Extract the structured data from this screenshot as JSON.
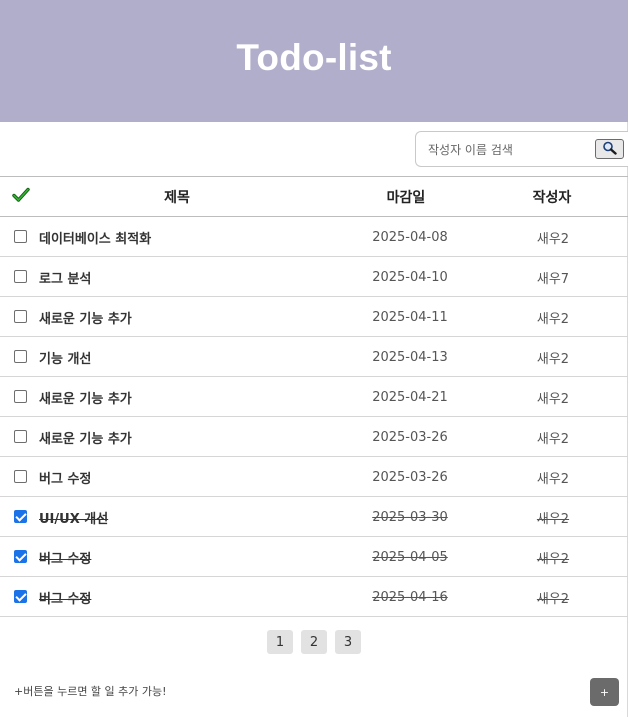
{
  "header": {
    "title": "Todo-list"
  },
  "search": {
    "placeholder": "작성자 이름 검색",
    "value": "",
    "button_icon": "magnifier-icon"
  },
  "table": {
    "columns": {
      "check_icon": "green-check-icon",
      "title": "제목",
      "due": "마감일",
      "author": "작성자"
    },
    "rows": [
      {
        "title": "데이터베이스 최적화",
        "due": "2025-04-08",
        "author": "새우2",
        "done": false
      },
      {
        "title": "로그 분석",
        "due": "2025-04-10",
        "author": "새우7",
        "done": false
      },
      {
        "title": "새로운 기능 추가",
        "due": "2025-04-11",
        "author": "새우2",
        "done": false
      },
      {
        "title": "기능 개선",
        "due": "2025-04-13",
        "author": "새우2",
        "done": false
      },
      {
        "title": "새로운 기능 추가",
        "due": "2025-04-21",
        "author": "새우2",
        "done": false
      },
      {
        "title": "새로운 기능 추가",
        "due": "2025-03-26",
        "author": "새우2",
        "done": false
      },
      {
        "title": "버그 수정",
        "due": "2025-03-26",
        "author": "새우2",
        "done": false
      },
      {
        "title": "UI/UX 개선",
        "due": "2025-03-30",
        "author": "새우2",
        "done": true
      },
      {
        "title": "버그 수정",
        "due": "2025-04-05",
        "author": "새우2",
        "done": true
      },
      {
        "title": "버그 수정",
        "due": "2025-04-16",
        "author": "새우2",
        "done": true
      }
    ]
  },
  "pagination": {
    "pages": [
      "1",
      "2",
      "3"
    ]
  },
  "footer": {
    "hint": "+버튼을 누르면 할 일 추가 가능!",
    "add_label": "+"
  },
  "colors": {
    "header_bg": "#b1aecb",
    "check_blue": "#1a73e8",
    "check_green": "#1f8f1f"
  }
}
